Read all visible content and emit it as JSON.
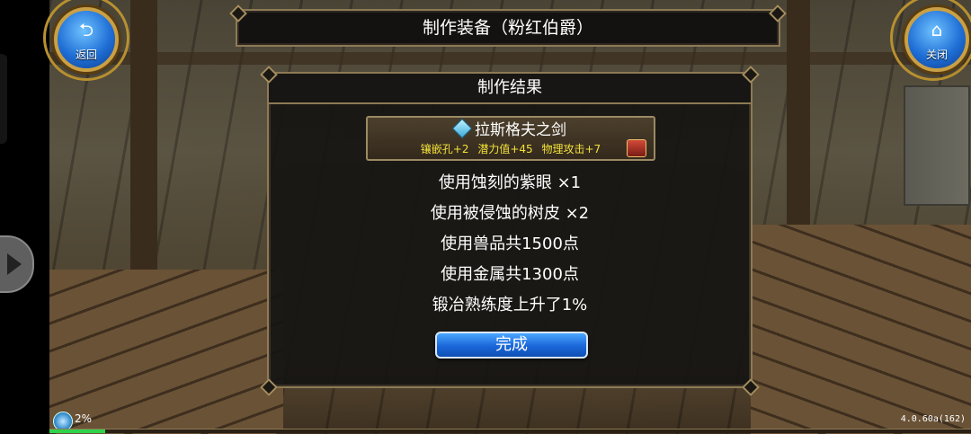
{
  "header": {
    "back_label": "返回",
    "close_label": "关闭",
    "title": "制作装备（粉红伯爵）"
  },
  "panel": {
    "title": "制作结果",
    "item": {
      "name": "拉斯格夫之剑",
      "stats": [
        "镶嵌孔+2",
        "潜力值+45",
        "物理攻击+7"
      ],
      "stat_color": "#f3e23a"
    },
    "lines": [
      "使用蚀刻的紫眼  ×1",
      "使用被侵蚀的树皮  ×2",
      "使用兽品共1500点",
      "使用金属共1300点",
      "锻冶熟练度上升了1%"
    ],
    "done_label": "完成"
  },
  "status": {
    "percent_text": "2%",
    "progress": 0.06,
    "progress_color": "#2fd24a",
    "version": "4.0.60a(162)"
  },
  "icons": {
    "back": "back-arrow-icon",
    "close": "home-icon",
    "item": "sword-gem-icon",
    "chest": "treasure-chest-icon",
    "status": "network-icon"
  }
}
